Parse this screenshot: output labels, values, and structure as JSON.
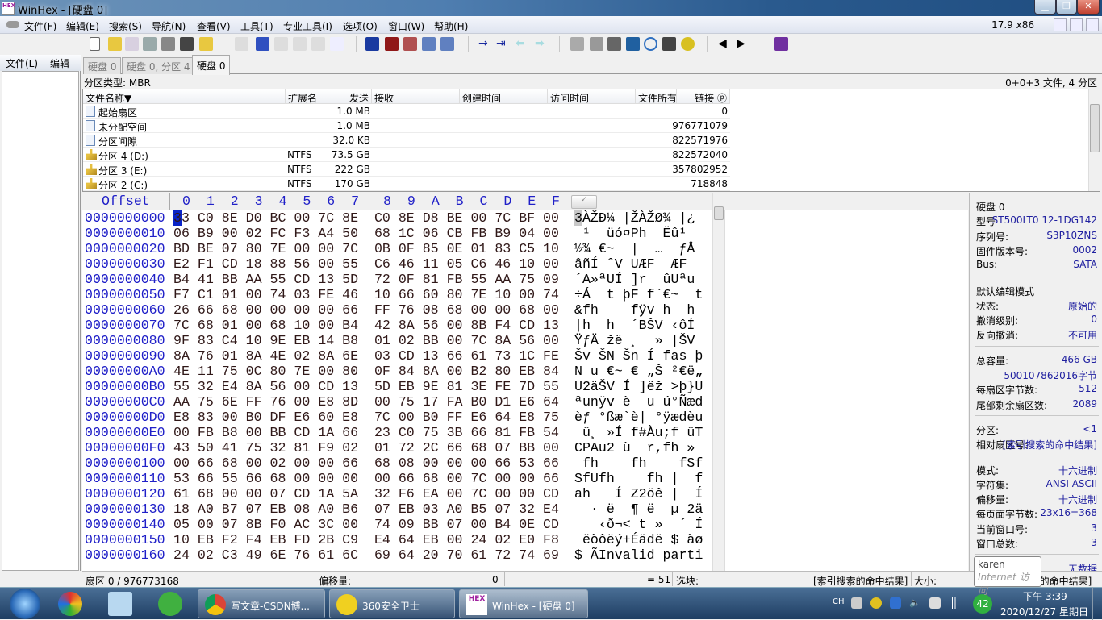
{
  "window": {
    "title": "WinHex - [硬盘 0]",
    "logo": "HEX",
    "zoom_readout": "17.9 x86"
  },
  "menu": [
    "文件(F)",
    "编辑(E)",
    "搜索(S)",
    "导航(N)",
    "查看(V)",
    "工具(T)",
    "专业工具(I)",
    "选项(O)",
    "窗口(W)",
    "帮助(H)"
  ],
  "left_panel": {
    "menu": [
      "文件(L)",
      "编辑(D"
    ]
  },
  "tabs": [
    "硬盘 0",
    "硬盘 0, 分区 4",
    "硬盘 0"
  ],
  "active_tab": 2,
  "partition_type": "分区类型: MBR",
  "partition_count": "0+0+3 文件, 4 分区",
  "file_list": {
    "columns": [
      "文件名称▼",
      "扩展名",
      "发送",
      "接收",
      "创建时间",
      "访问时间",
      "文件所有",
      "链接 ⓟ"
    ],
    "rows": [
      {
        "icon": "file",
        "name": "起始扇区",
        "ext": "",
        "size": "1.0 MB",
        "link": "0"
      },
      {
        "icon": "file",
        "name": "未分配空间",
        "ext": "",
        "size": "1.0 MB",
        "link": "976771079"
      },
      {
        "icon": "file",
        "name": "分区间隙",
        "ext": "",
        "size": "32.0 KB",
        "link": "822571976"
      },
      {
        "icon": "partition",
        "name": "分区 4 (D:)",
        "ext": "NTFS",
        "size": "73.5 GB",
        "link": "822572040"
      },
      {
        "icon": "partition",
        "name": "分区 3 (E:)",
        "ext": "NTFS",
        "size": "222 GB",
        "link": "357802952"
      },
      {
        "icon": "partition",
        "name": "分区 2 (C:)",
        "ext": "NTFS",
        "size": "170 GB",
        "link": "718848"
      }
    ]
  },
  "hex": {
    "header_offset": "Offset",
    "header_cols": "0  1  2  3  4  5  6  7   8  9  A  B  C  D  E  F",
    "cursor": "3",
    "rows": [
      {
        "o": "0000000000",
        "h": "33 C0 8E D0 BC 00 7C 8E  C0 8E D8 BE 00 7C BF 00",
        "t": "3ÀŽÐ¼ |ŽÀŽØ¾ |¿ "
      },
      {
        "o": "0000000010",
        "h": "06 B9 00 02 FC F3 A4 50  68 1C 06 CB FB B9 04 00",
        "t": " ¹  üó¤Ph  Ëû¹  "
      },
      {
        "o": "0000000020",
        "h": "BD BE 07 80 7E 00 00 7C  0B 0F 85 0E 01 83 C5 10",
        "t": "½¾ €~  |  …  ƒÅ "
      },
      {
        "o": "0000000030",
        "h": "E2 F1 CD 18 88 56 00 55  C6 46 11 05 C6 46 10 00",
        "t": "âñÍ ˆV UÆF  ÆF  "
      },
      {
        "o": "0000000040",
        "h": "B4 41 BB AA 55 CD 13 5D  72 0F 81 FB 55 AA 75 09",
        "t": "´A»ªUÍ ]r  ûUªu "
      },
      {
        "o": "0000000050",
        "h": "F7 C1 01 00 74 03 FE 46  10 66 60 80 7E 10 00 74",
        "t": "÷Á  t þF f`€~  t"
      },
      {
        "o": "0000000060",
        "h": "26 66 68 00 00 00 00 66  FF 76 08 68 00 00 68 00",
        "t": "&fh    fÿv h  h "
      },
      {
        "o": "0000000070",
        "h": "7C 68 01 00 68 10 00 B4  42 8A 56 00 8B F4 CD 13",
        "t": "|h  h  ´BŠV ‹ôÍ "
      },
      {
        "o": "0000000080",
        "h": "9F 83 C4 10 9E EB 14 B8  01 02 BB 00 7C 8A 56 00",
        "t": "ŸƒÄ žë ¸  » |ŠV "
      },
      {
        "o": "0000000090",
        "h": "8A 76 01 8A 4E 02 8A 6E  03 CD 13 66 61 73 1C FE",
        "t": "Šv ŠN Šn Í fas þ"
      },
      {
        "o": "00000000A0",
        "h": "4E 11 75 0C 80 7E 00 80  0F 84 8A 00 B2 80 EB 84",
        "t": "N u €~ € „Š ²€ë„"
      },
      {
        "o": "00000000B0",
        "h": "55 32 E4 8A 56 00 CD 13  5D EB 9E 81 3E FE 7D 55",
        "t": "U2äŠV Í ]ëž >þ}U"
      },
      {
        "o": "00000000C0",
        "h": "AA 75 6E FF 76 00 E8 8D  00 75 17 FA B0 D1 E6 64",
        "t": "ªunÿv è  u ú°Ñæd"
      },
      {
        "o": "00000000D0",
        "h": "E8 83 00 B0 DF E6 60 E8  7C 00 B0 FF E6 64 E8 75",
        "t": "èƒ °ßæ`è| °ÿædèu"
      },
      {
        "o": "00000000E0",
        "h": "00 FB B8 00 BB CD 1A 66  23 C0 75 3B 66 81 FB 54",
        "t": " û¸ »Í f#Àu;f ûT"
      },
      {
        "o": "00000000F0",
        "h": "43 50 41 75 32 81 F9 02  01 72 2C 66 68 07 BB 00",
        "t": "CPAu2 ù  r,fh » "
      },
      {
        "o": "0000000100",
        "h": "00 66 68 00 02 00 00 66  68 08 00 00 00 66 53 66",
        "t": " fh    fh    fSf"
      },
      {
        "o": "0000000110",
        "h": "53 66 55 66 68 00 00 00  00 66 68 00 7C 00 00 66",
        "t": "SfUfh    fh |  f"
      },
      {
        "o": "0000000120",
        "h": "61 68 00 00 07 CD 1A 5A  32 F6 EA 00 7C 00 00 CD",
        "t": "ah   Í Z2öê |  Í"
      },
      {
        "o": "0000000130",
        "h": "18 A0 B7 07 EB 08 A0 B6  07 EB 03 A0 B5 07 32 E4",
        "t": "  · ë  ¶ ë  µ 2ä"
      },
      {
        "o": "0000000140",
        "h": "05 00 07 8B F0 AC 3C 00  74 09 BB 07 00 B4 0E CD",
        "t": "   ‹ð¬< t »  ´ Í"
      },
      {
        "o": "0000000150",
        "h": "10 EB F2 F4 EB FD 2B C9  E4 64 EB 00 24 02 E0 F8",
        "t": " ëòôëý+Éädë $ àø"
      },
      {
        "o": "0000000160",
        "h": "24 02 C3 49 6E 76 61 6C  69 64 20 70 61 72 74 69",
        "t": "$ ÃInvalid parti"
      }
    ]
  },
  "info_panel": {
    "groups": [
      [
        {
          "k": "硬盘 0",
          "v": ""
        },
        {
          "k": "型号",
          "v": "ST500LT0 12-1DG142"
        },
        {
          "k": "序列号:",
          "v": "S3P10ZNS"
        },
        {
          "k": "固件版本号:",
          "v": "0002"
        },
        {
          "k": "Bus:",
          "v": "SATA"
        }
      ],
      [
        {
          "k": "默认编辑模式",
          "v": ""
        },
        {
          "k": "状态:",
          "v": "原始的"
        },
        {
          "k": "撤消级别:",
          "v": "0"
        },
        {
          "k": "反向撤消:",
          "v": "不可用"
        }
      ],
      [
        {
          "k": "总容量:",
          "v": "466 GB"
        },
        {
          "k": "",
          "v": "500107862016字节"
        },
        {
          "k": "每扇区字节数:",
          "v": "512"
        },
        {
          "k": "尾部剩余扇区数:",
          "v": "2089"
        }
      ],
      [
        {
          "k": "分区:",
          "v": "<1"
        },
        {
          "k": "相对扇区号:",
          "v": "[索引搜索的命中结果]"
        }
      ],
      [
        {
          "k": "模式:",
          "v": "十六进制"
        },
        {
          "k": "字符集:",
          "v": "ANSI ASCII"
        },
        {
          "k": "偏移量:",
          "v": "十六进制"
        },
        {
          "k": "每页面字节数:",
          "v": "23x16=368"
        },
        {
          "k": "当前窗口号:",
          "v": "3"
        },
        {
          "k": "窗口总数:",
          "v": "3"
        }
      ],
      [
        {
          "k": "剪贴板:",
          "v": "无数据"
        }
      ]
    ]
  },
  "status": {
    "sector": "扇区 0 / 976773168",
    "offset_label": "偏移量:",
    "offset_value": "0",
    "eq": "= 51",
    "block_label": "选块:",
    "block_value": "[索引搜索的命中结果]",
    "size_label": "大小:",
    "size_value": "[索引搜索的命中结果]"
  },
  "tooltip": {
    "user": "karen",
    "access": "Internet 访问"
  },
  "taskbar": {
    "tasks": [
      "写文章-CSDN博...",
      "360安全卫士",
      "WinHex - [硬盘 0]"
    ],
    "ime": "CH",
    "badge": "42",
    "time": "下午 3:39",
    "date": "2020/12/27 星期日"
  },
  "colors": {
    "offset": "#2020c8",
    "selection": "#0a24c8",
    "accent": "#2020a0"
  }
}
